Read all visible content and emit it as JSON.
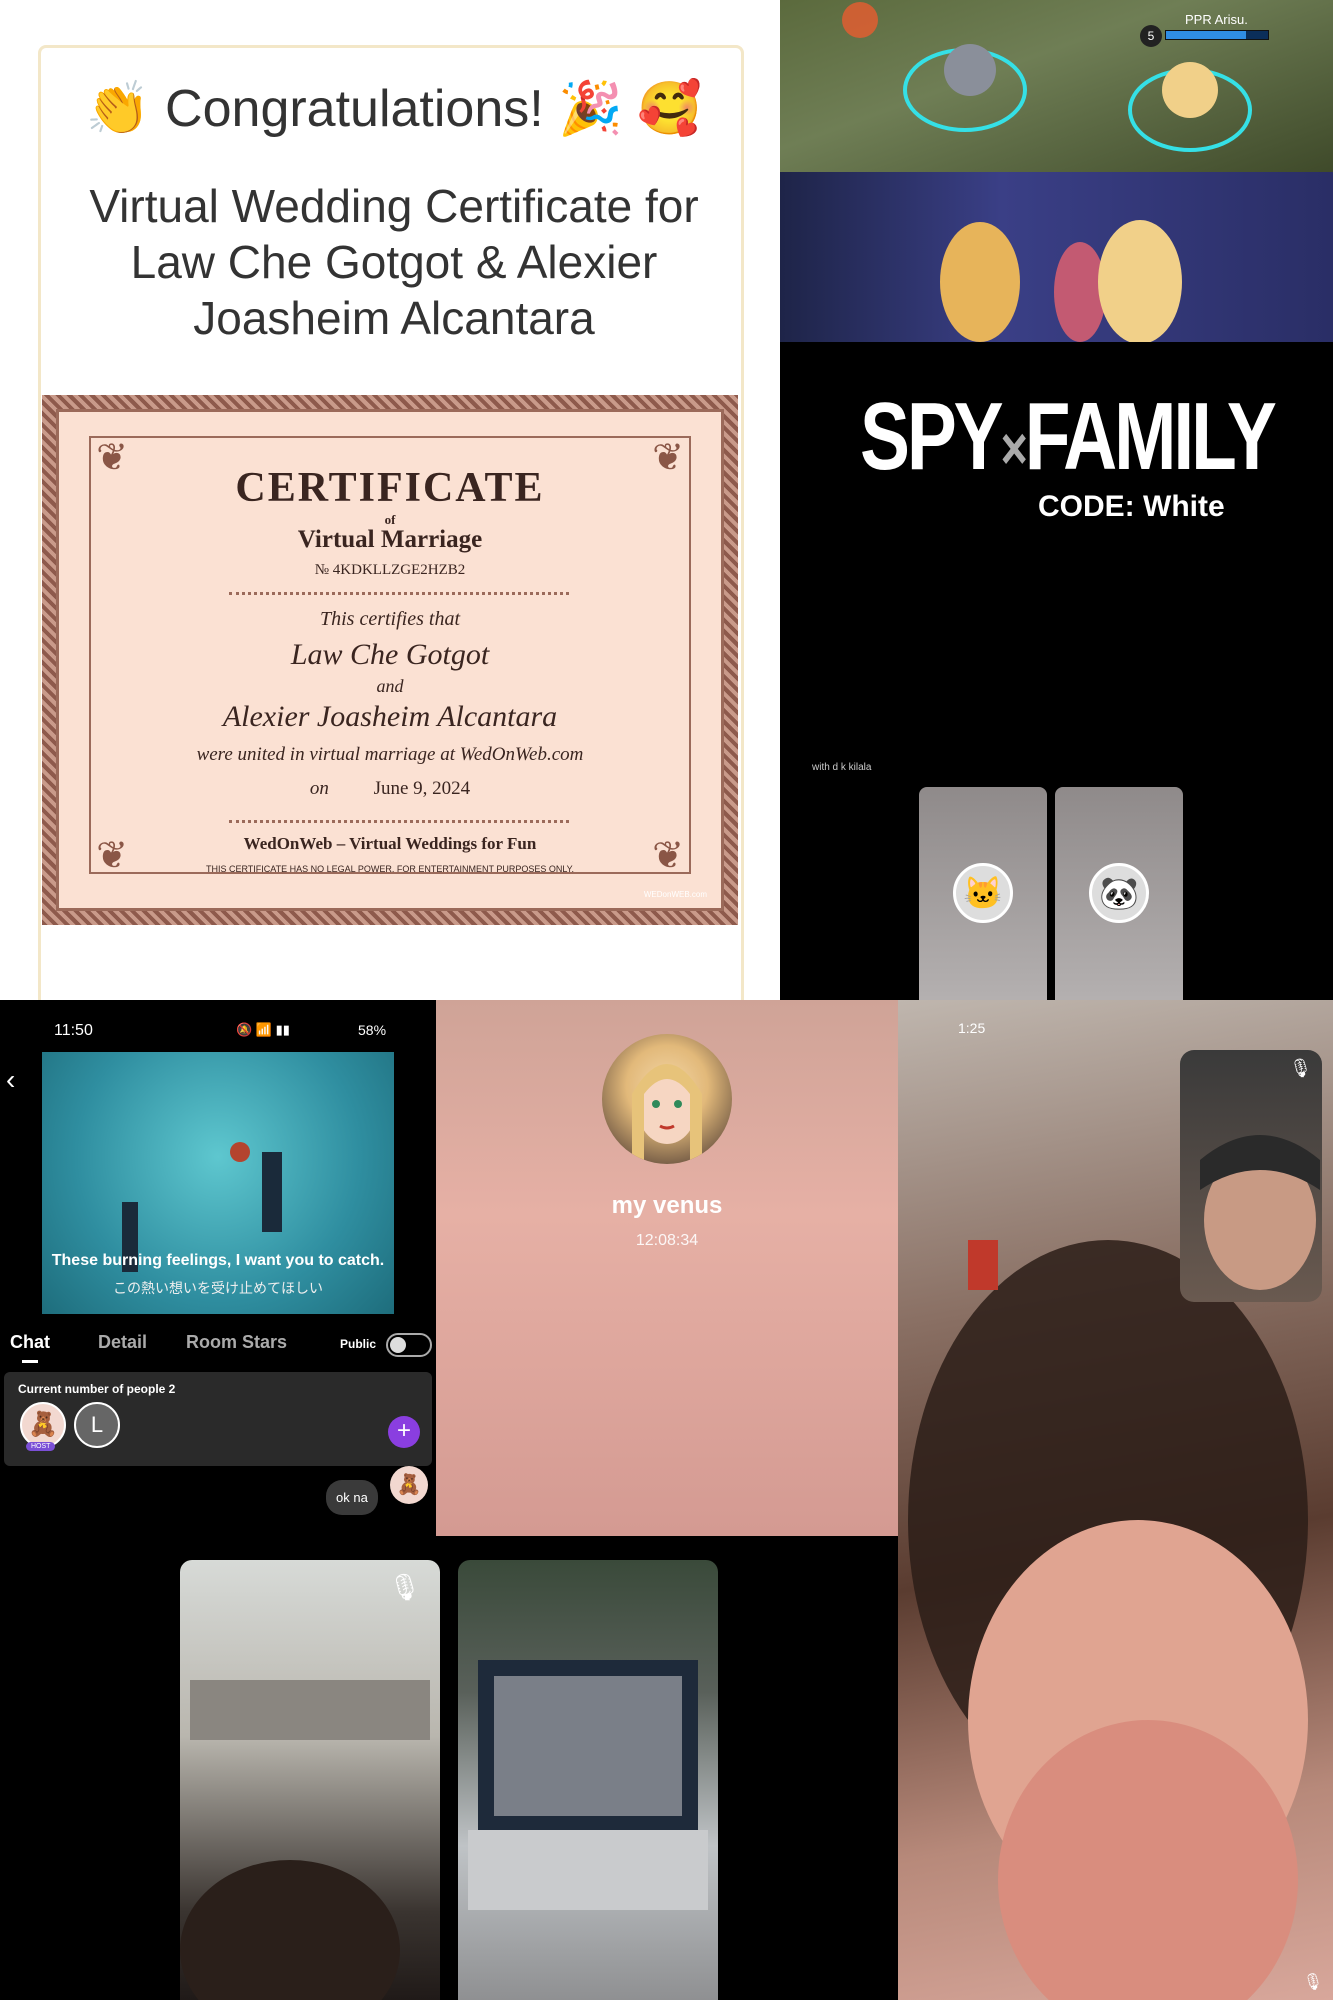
{
  "certificate_panel": {
    "congrats_text": "Congratulations!",
    "congrats_emoji_left": "👏",
    "congrats_emoji_right": "🎉 🥰",
    "heading": "Virtual Wedding Certificate for Law Che Gotgot & Alexier Joasheim Alcantara",
    "certificate": {
      "title": "CERTIFICATE",
      "of": "of",
      "subtitle": "Virtual Marriage",
      "number": "№ 4KDKLLZGE2HZB2",
      "certifies": "This certifies that",
      "name1": "Law Che Gotgot",
      "and": "and",
      "name2": "Alexier Joasheim Alcantara",
      "united": "were united in virtual marriage at WedOnWeb.com",
      "on_label": "on",
      "date": "June 9, 2024",
      "footer": "WedOnWeb – Virtual Weddings for Fun",
      "disclaimer": "THIS CERTIFICATE HAS NO LEGAL POWER. FOR ENTERTAINMENT PURPOSES ONLY.",
      "watermark": "WEDonWEB.com"
    }
  },
  "game_panel": {
    "player_name": "PPR Arisu.",
    "player_level": "5",
    "hp_fraction": 0.78
  },
  "spy_panel": {
    "logo_spy": "SPY",
    "logo_x": "×",
    "logo_family": "FAMILY",
    "code": "CODE: White",
    "with_text": "with d k kilala"
  },
  "chat_panel": {
    "time": "11:50",
    "battery": "58%",
    "subtitle_en": "These burning feelings, I want you to catch.",
    "subtitle_jp": "この熱い想いを受け止めてほしい",
    "tabs": [
      "Chat",
      "Detail",
      "Room Stars"
    ],
    "public_label": "Public",
    "people_count_label": "Current number of people 2",
    "host_badge": "HOST",
    "guest_initial": "L",
    "message": "ok na"
  },
  "call_panel": {
    "name": "my venus",
    "timer": "12:08:34"
  },
  "video_call_panel": {
    "time": "1:25"
  },
  "icons": {
    "back": "chevron-left-icon",
    "mute": "mic-off-icon",
    "add": "plus-icon"
  }
}
